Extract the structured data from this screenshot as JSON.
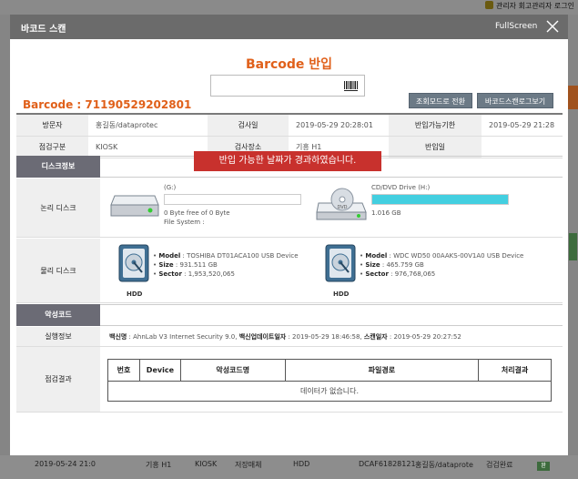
{
  "background": {
    "top_right_text": "관리자 회고관리자 로그인",
    "bottom_row": [
      "2019-05-24 21:0",
      "기흥 H1",
      "KIOSK",
      "저장매체",
      "HDD",
      "DCAF61828121",
      "홍길동/dataprote",
      "검검완료"
    ],
    "bottom_badge": "완"
  },
  "modal": {
    "title": "바코드 스캔",
    "fullscreen_label": "FullScreen",
    "heading": "Barcode 반입",
    "scan_input_value": "",
    "buttons": {
      "lookup_mode": "조회모드로 전환",
      "barcode_screen_view": "바코드스캔로그보기"
    },
    "barcode_label": "Barcode : 71190529202801"
  },
  "info": {
    "row1": {
      "visitor_label": "방문자",
      "visitor": "홍길동/dataprotec",
      "inspect_date_label": "검사일",
      "inspect_date": "2019-05-29 20:28:01",
      "deadline_label": "반입가능기한",
      "deadline": "2019-05-29 21:28"
    },
    "row2": {
      "category_label": "점검구분",
      "category": "KIOSK",
      "place_label": "검사장소",
      "place": "기흥 H1",
      "entry_date_label": "반입일",
      "entry_date": ""
    }
  },
  "alert": "반입 가능한 날짜가 경과하였습니다.",
  "disk_info": {
    "section_title": "디스크정보",
    "logical_label": "논리 디스크",
    "logical": [
      {
        "name": "(G:)",
        "usage_text": "0 Byte free of 0 Byte",
        "fs_text": "File System :",
        "fill_pct": 0
      },
      {
        "name": "CD/DVD Drive (H:)",
        "usage_text": "1.016 GB",
        "fs_text": "",
        "fill_pct": 100
      }
    ],
    "physical_label": "물리 디스크",
    "physical": [
      {
        "model_label": "Model",
        "model": "TOSHIBA DT01ACA100 USB Device",
        "size_label": "Size",
        "size": "931.511 GB",
        "sector_label": "Sector",
        "sector": "1,953,520,065",
        "caption": "HDD"
      },
      {
        "model_label": "Model",
        "model": "WDC WD50 00AAKS-00V1A0 USB Device",
        "size_label": "Size",
        "size": "465.759 GB",
        "sector_label": "Sector",
        "sector": "976,768,065",
        "caption": "HDD"
      }
    ]
  },
  "malware": {
    "section_title": "악성코드",
    "run_info_label": "실행정보",
    "vaccine_label": "백신명",
    "vaccine": "AhnLab V3 Internet Security 9.0",
    "update_label": "백신업데이트일자",
    "update": "2019-05-29 18:46:58",
    "scan_label": "스캔일자",
    "scan": "2019-05-29 20:27:52",
    "result_label": "점검결과",
    "table_headers": [
      "번호",
      "Device",
      "악성코드명",
      "파일경로",
      "처리결과"
    ],
    "empty_text": "데이터가 없습니다."
  },
  "colors": {
    "accent": "#e0601a",
    "alert": "#c8312d",
    "section": "#6b6b75",
    "cd_fill": "#43cfe0"
  }
}
